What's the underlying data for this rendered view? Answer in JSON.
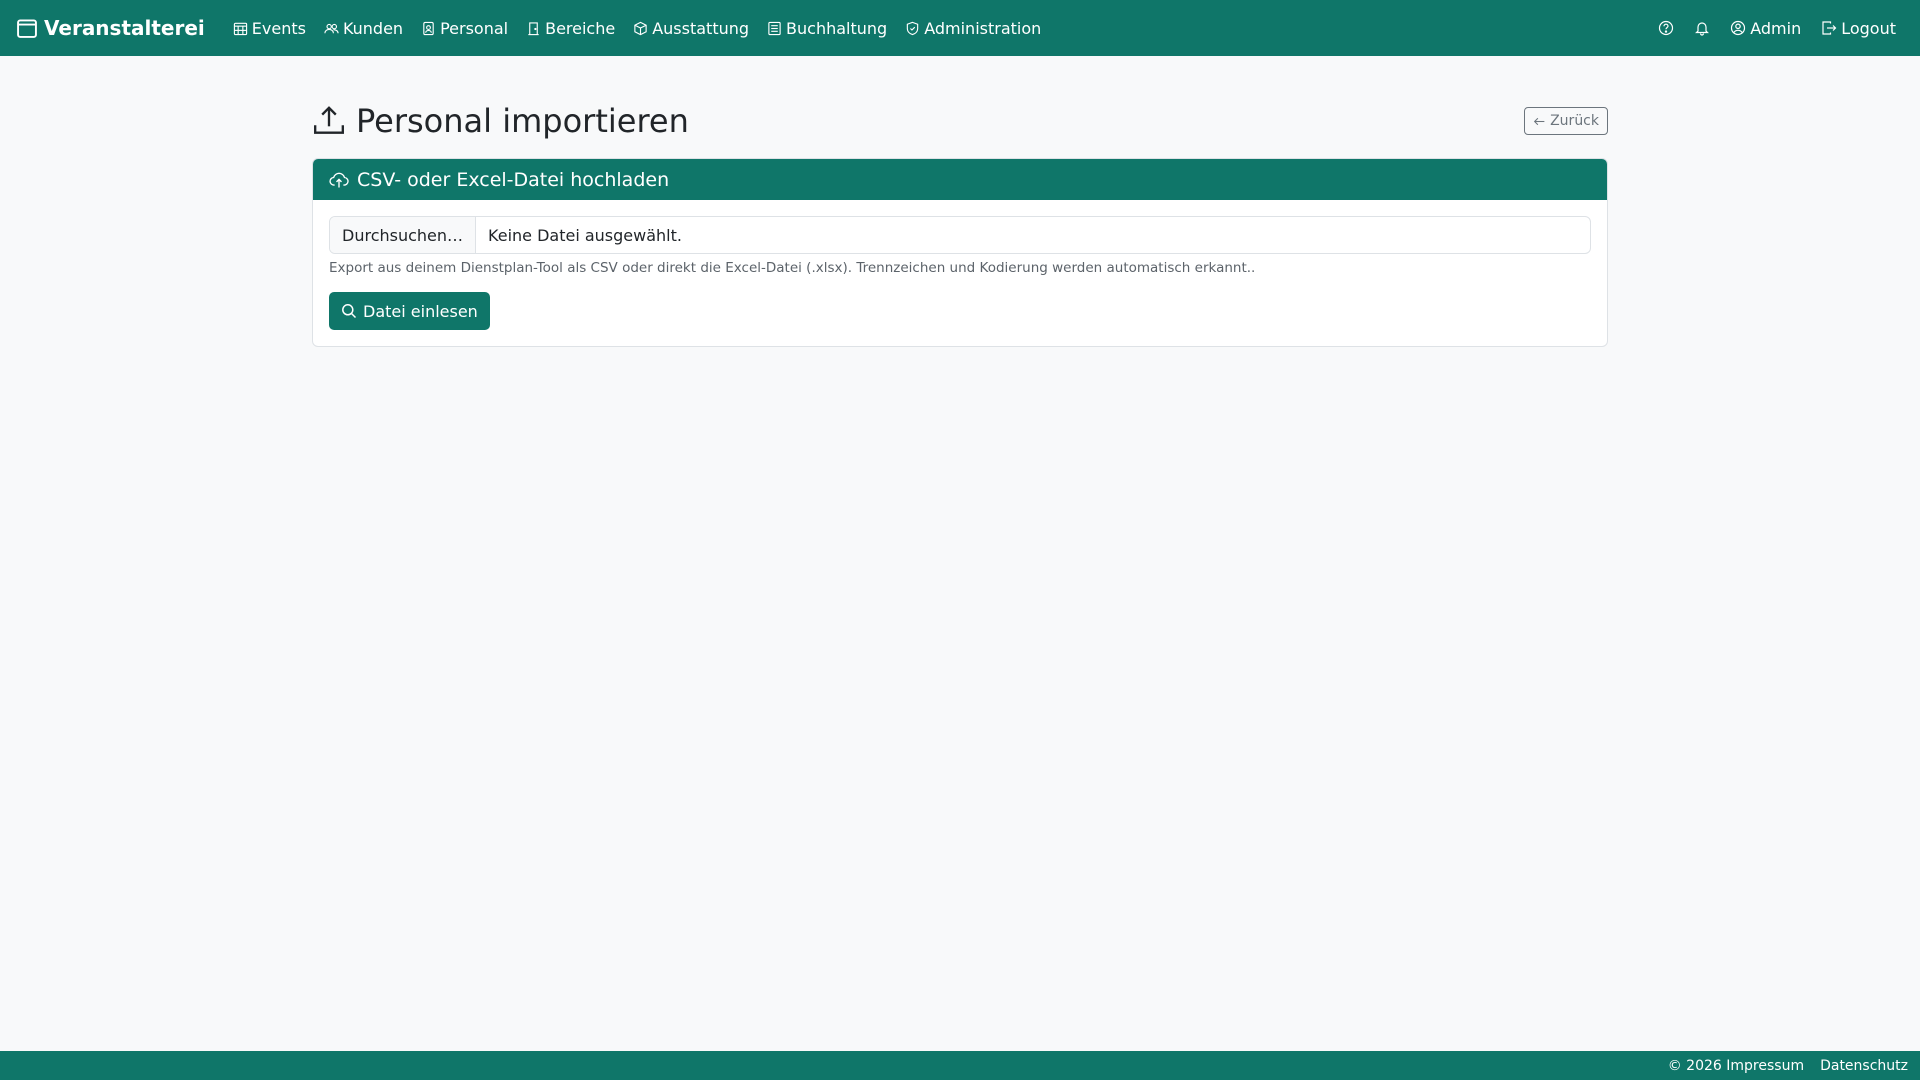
{
  "navbar": {
    "brand": "Veranstalterei",
    "items": [
      {
        "label": "Events",
        "icon": "calendar-grid-icon"
      },
      {
        "label": "Kunden",
        "icon": "people-icon"
      },
      {
        "label": "Personal",
        "icon": "person-badge-icon"
      },
      {
        "label": "Bereiche",
        "icon": "door-icon"
      },
      {
        "label": "Ausstattung",
        "icon": "box-icon"
      },
      {
        "label": "Buchhaltung",
        "icon": "ledger-icon"
      },
      {
        "label": "Administration",
        "icon": "shield-icon"
      }
    ],
    "right": {
      "help_icon": "question-circle-icon",
      "bell_icon": "bell-icon",
      "user_label": "Admin",
      "logout_label": "Logout"
    }
  },
  "page": {
    "title": "Personal importieren",
    "back_label": "Zurück"
  },
  "card": {
    "header": "CSV- oder Excel-Datei hochladen",
    "file_button": "Durchsuchen…",
    "file_status": "Keine Datei ausgewählt.",
    "help": "Export aus deinem Dienstplan-Tool als CSV oder direkt die Excel-Datei (.xlsx). Trennzeichen und Kodierung werden automatisch erkannt..",
    "submit_label": "Datei einlesen"
  },
  "footer": {
    "impressum": "© 2026 Impressum",
    "datenschutz": "Datenschutz"
  },
  "colors": {
    "primary": "#0f7669",
    "background": "#f8f9fa"
  }
}
